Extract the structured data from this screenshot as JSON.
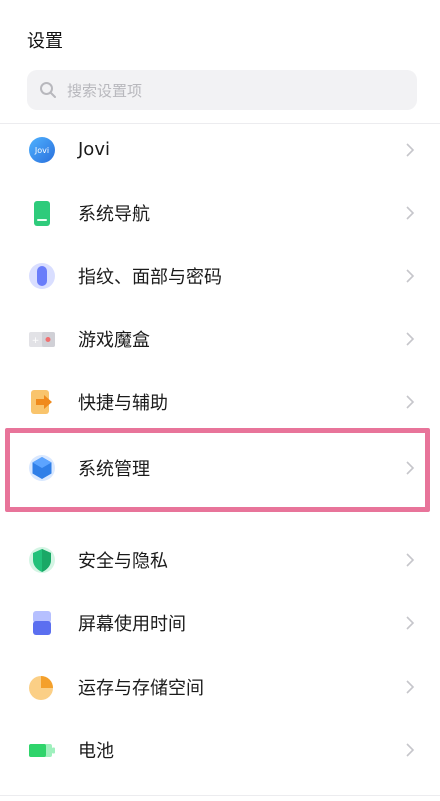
{
  "header": {
    "title": "设置"
  },
  "search": {
    "placeholder": "搜索设置项"
  },
  "items": [
    {
      "label": "Jovi",
      "icon": "jovi-icon",
      "color": "#3b8bea"
    },
    {
      "label": "系统导航",
      "icon": "phone-navigation-icon",
      "color": "#2ecb7b"
    },
    {
      "label": "指纹、面部与密码",
      "icon": "fingerprint-icon",
      "color": "#6a7dfa"
    },
    {
      "label": "游戏魔盒",
      "icon": "game-box-icon",
      "color": "#d9d9de"
    },
    {
      "label": "快捷与辅助",
      "icon": "shortcut-arrow-icon",
      "color": "#f5a23a"
    },
    {
      "label": "系统管理",
      "icon": "system-hexagon-icon",
      "color": "#2f7fe8"
    },
    {
      "label": "安全与隐私",
      "icon": "shield-icon",
      "color": "#22c17a"
    },
    {
      "label": "屏幕使用时间",
      "icon": "screen-time-icon",
      "color": "#5b6ff0"
    },
    {
      "label": "运存与存储空间",
      "icon": "storage-pie-icon",
      "color": "#f4a02c"
    },
    {
      "label": "电池",
      "icon": "battery-icon",
      "color": "#2fd46b"
    }
  ],
  "highlight": {
    "target": "系统管理",
    "color": "#e8749a"
  }
}
